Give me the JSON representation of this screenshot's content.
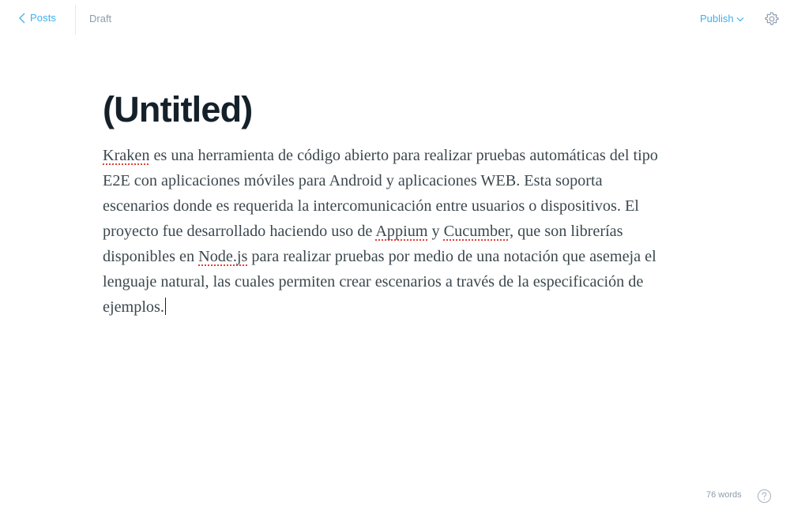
{
  "header": {
    "back_label": "Posts",
    "status": "Draft",
    "publish_label": "Publish"
  },
  "post": {
    "title": "(Untitled)",
    "body": [
      {
        "text": "Kraken",
        "misspelled": true
      },
      {
        "text": " es una herramienta de código abierto para realizar pruebas automáticas del tipo E2E con aplicaciones móviles para Android y aplicaciones WEB. Esta soporta escenarios donde es requerida la intercomunicación entre usuarios o dispositivos. El proyecto fue desarrollado haciendo uso de ",
        "misspelled": false
      },
      {
        "text": "Appium",
        "misspelled": true
      },
      {
        "text": " y ",
        "misspelled": false
      },
      {
        "text": "Cucumber",
        "misspelled": true
      },
      {
        "text": ", que son librerías disponibles en ",
        "misspelled": false
      },
      {
        "text": "Node.js",
        "misspelled": true
      },
      {
        "text": " para realizar pruebas por medio de una notación que asemeja el lenguaje natural, las cuales permiten crear escenarios a través de la especificación de ejemplos.",
        "misspelled": false
      }
    ]
  },
  "footer": {
    "word_count": "76 words"
  },
  "icons": {
    "back": "chevron-left-icon",
    "publish_dropdown": "chevron-down-icon",
    "settings": "gear-icon",
    "help": "question-circle-icon"
  },
  "colors": {
    "accent": "#3eb0ef",
    "muted": "#8e9cac",
    "title": "#15212a",
    "body": "#3c484e",
    "spellcheck": "#e0403a"
  }
}
